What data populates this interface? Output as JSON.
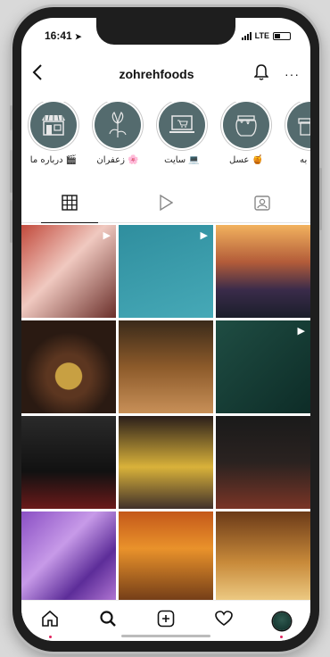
{
  "status_bar": {
    "time": "16:41",
    "network": "LTE"
  },
  "header": {
    "username": "zohrehfoods"
  },
  "highlights": [
    {
      "label": "درباره ما 🎬",
      "icon": "shop-icon"
    },
    {
      "label": "زعفران 🌸",
      "icon": "saffron-flower-icon"
    },
    {
      "label": "سایت 💻",
      "icon": "laptop-cart-icon"
    },
    {
      "label": "عسل 🍯",
      "icon": "honey-pot-icon"
    },
    {
      "label": "به 🎁",
      "icon": "gift-box-icon"
    }
  ],
  "posts": [
    {
      "name": "post-woman-portrait",
      "badge": "▶",
      "bg": "linear-gradient(135deg,#c24a3c,#f0c9c0 45%,#6a2f2a)",
      "caption": ""
    },
    {
      "name": "post-website-monitor",
      "badge": "▶",
      "bg": "linear-gradient(160deg,#2f8e9e,#46a9b7)",
      "caption": ""
    },
    {
      "name": "post-saffron-flowers-sunset",
      "badge": "",
      "bg": "linear-gradient(180deg,#f2b25e,#b35c39 40%,#3a2b4a 70%,#1b1e2a)",
      "caption": ""
    },
    {
      "name": "post-saffron-bowl",
      "badge": "",
      "bg": "radial-gradient(circle at 50% 60%,#c8a042 0 18%,#5c3620 19% 30%,#2a1a12 60%)",
      "caption": ""
    },
    {
      "name": "post-honey-jar",
      "badge": "",
      "bg": "linear-gradient(180deg,#3a2a1a,#8c5a2a 50%,#c89058)",
      "caption": ""
    },
    {
      "name": "post-zohreh-logo",
      "badge": "▶",
      "bg": "linear-gradient(135deg,#1f4d43,#0d2c27)",
      "caption": ""
    },
    {
      "name": "post-saffron-box",
      "badge": "",
      "bg": "linear-gradient(180deg,#2a2a2a,#111 60%,#6b1a1a)",
      "caption": ""
    },
    {
      "name": "post-saffron-dessert",
      "badge": "",
      "bg": "linear-gradient(180deg,#2a1e1a,#d9b23a 55%,#40302a)",
      "caption": ""
    },
    {
      "name": "post-saffron-jar",
      "badge": "",
      "bg": "linear-gradient(180deg,#1a1a1a,#2a2220 50%,#7a3526)",
      "caption": ""
    },
    {
      "name": "post-purple-flowers",
      "badge": "",
      "bg": "linear-gradient(135deg,#8a4fc4,#c79ae8 40%,#5d2d99 70%,#b67ad6)",
      "caption": ""
    },
    {
      "name": "post-honey-dip",
      "badge": "",
      "bg": "linear-gradient(180deg,#c4581a,#e9922b 40%,#6b3716)",
      "caption": ""
    },
    {
      "name": "post-honeycomb",
      "badge": "",
      "bg": "linear-gradient(180deg,#6b3a18,#c88a3a 55%,#f0d08a)",
      "caption": ""
    }
  ],
  "colors": {
    "highlight_bg": "#546b6e",
    "badge_dot": "#e0245e"
  }
}
